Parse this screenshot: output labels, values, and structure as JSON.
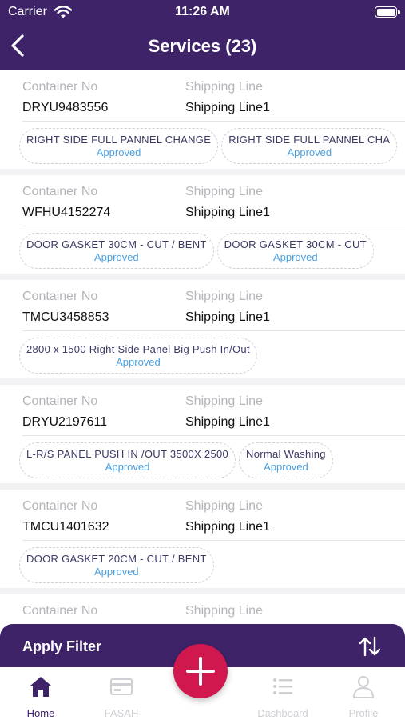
{
  "status_bar": {
    "carrier": "Carrier",
    "time": "11:26 AM"
  },
  "header": {
    "title": "Services (23)"
  },
  "labels": {
    "container_no": "Container No",
    "shipping_line": "Shipping Line"
  },
  "services": [
    {
      "container_no": "DRYU9483556",
      "shipping_line": "Shipping Line1",
      "jobs": [
        {
          "name": "RIGHT SIDE FULL PANNEL CHANGE",
          "status": "Approved"
        },
        {
          "name": "RIGHT SIDE FULL PANNEL CHA",
          "status": "Approved"
        }
      ]
    },
    {
      "container_no": "WFHU4152274",
      "shipping_line": "Shipping Line1",
      "jobs": [
        {
          "name": "DOOR GASKET 30CM  - CUT / BENT",
          "status": "Approved"
        },
        {
          "name": "DOOR GASKET 30CM  - CUT",
          "status": "Approved"
        }
      ]
    },
    {
      "container_no": "TMCU3458853",
      "shipping_line": "Shipping Line1",
      "jobs": [
        {
          "name": "2800 x 1500 Right Side Panel Big Push In/Out",
          "status": "Approved"
        }
      ]
    },
    {
      "container_no": "DRYU2197611",
      "shipping_line": "Shipping Line1",
      "jobs": [
        {
          "name": "L-R/S PANEL PUSH IN /OUT 3500X 2500",
          "status": "Approved"
        },
        {
          "name": "Normal Washing",
          "status": "Approved"
        }
      ]
    },
    {
      "container_no": "TMCU1401632",
      "shipping_line": "Shipping Line1",
      "jobs": [
        {
          "name": "DOOR GASKET 20CM  - CUT / BENT",
          "status": "Approved"
        }
      ]
    },
    {
      "container_no": "",
      "shipping_line": "",
      "jobs": []
    }
  ],
  "filter": {
    "label": "Apply Filter",
    "icon": "sort-icon"
  },
  "tabs": [
    {
      "label": "Home",
      "icon": "home-icon",
      "active": true
    },
    {
      "label": "FASAH",
      "icon": "card-icon",
      "active": false
    },
    {
      "label": "Dashboard",
      "icon": "list-icon",
      "active": false
    },
    {
      "label": "Profile",
      "icon": "person-icon",
      "active": false
    }
  ],
  "colors": {
    "primary": "#3e2369",
    "fab": "#d0184f",
    "status": "#4aa0e0",
    "label": "#b5b5bb"
  }
}
